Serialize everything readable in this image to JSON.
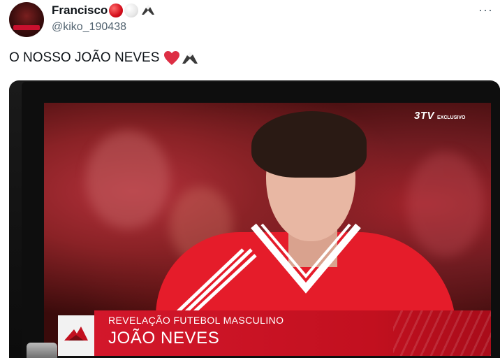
{
  "tweet": {
    "author": {
      "display_name": "Francisco",
      "handle": "@kiko_190438",
      "name_emojis": [
        "red-circle",
        "white-circle",
        "eagle"
      ]
    },
    "text": "O NOSSO JOÃO NEVES",
    "text_emojis": [
      "red-heart",
      "eagle"
    ],
    "more_icon": "more-options-icon"
  },
  "media": {
    "channel_logo": "3TV",
    "channel_tag": "EXCLUSIVO",
    "caption_subtitle": "REVELAÇÃO FUTEBOL MASCULINO",
    "caption_name": "JOÃO NEVES"
  },
  "colors": {
    "benfica_red": "#c2101f",
    "shirt_red": "#e51c2a",
    "handle_gray": "#536471",
    "text_dark": "#0f1419"
  }
}
